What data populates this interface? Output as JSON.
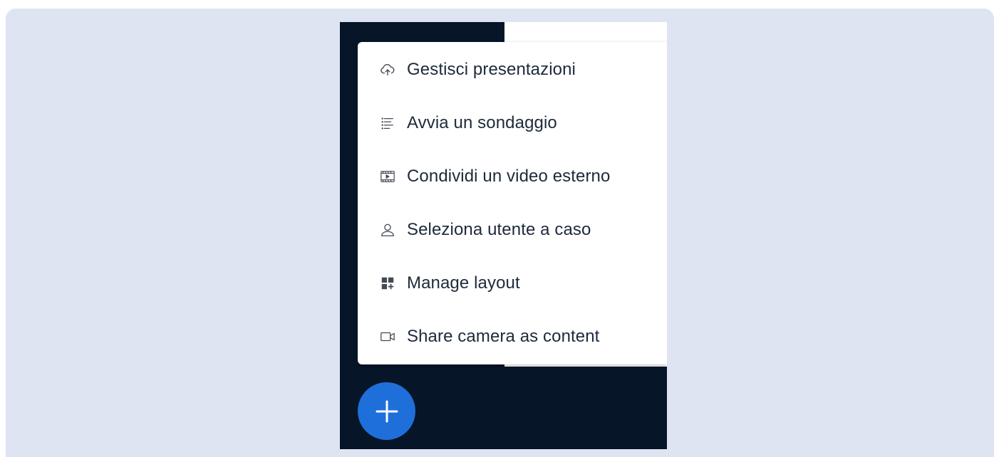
{
  "menu": {
    "items": [
      {
        "icon": "upload-cloud-icon",
        "label": "Gestisci presentazioni"
      },
      {
        "icon": "poll-list-icon",
        "label": "Avvia un sondaggio"
      },
      {
        "icon": "video-film-icon",
        "label": "Condividi un video esterno"
      },
      {
        "icon": "user-icon",
        "label": "Seleziona utente a caso"
      },
      {
        "icon": "layout-grid-icon",
        "label": "Manage layout"
      },
      {
        "icon": "camera-icon",
        "label": "Share camera as content"
      }
    ]
  },
  "fab": {
    "icon": "plus-icon"
  },
  "colors": {
    "page_background": "#dfe4f2",
    "panel_background": "#061528",
    "fab_blue": "#1f6fdb",
    "menu_text": "#1e2a3a"
  }
}
